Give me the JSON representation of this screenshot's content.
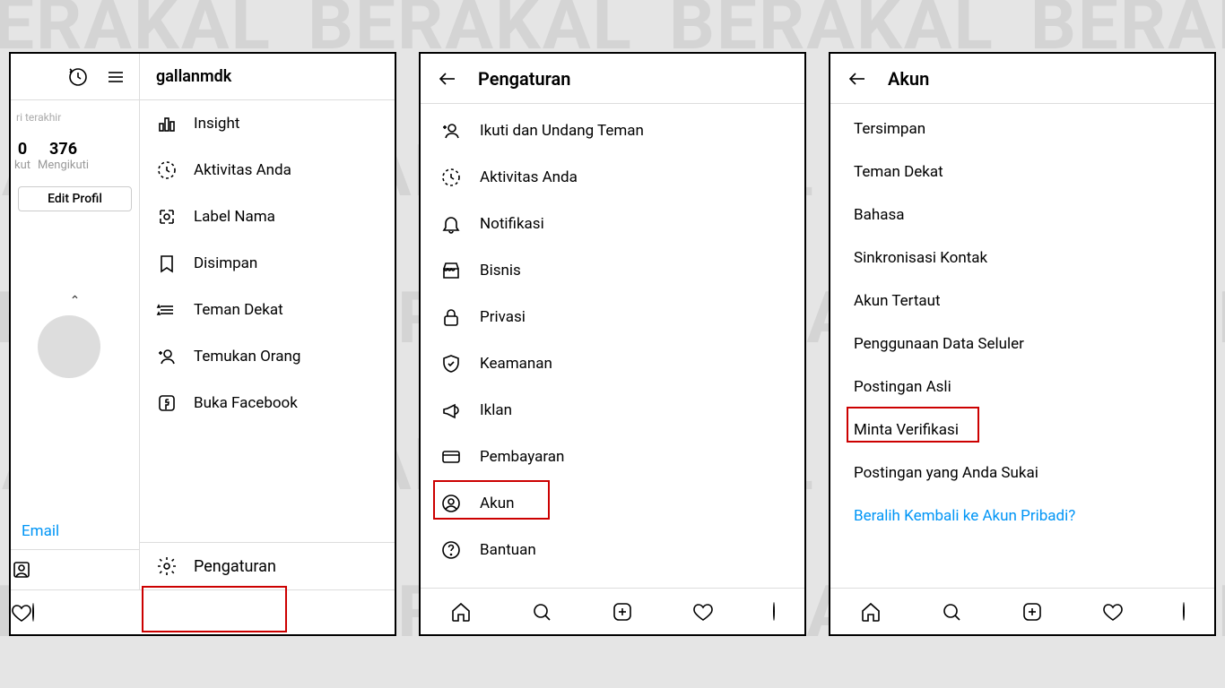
{
  "phone1": {
    "username": "gallanmdk",
    "tiny": "ri terakhir",
    "stat1_num": "0",
    "stat1_lbl": "kut",
    "stat2_num": "376",
    "stat2_lbl": "Mengikuti",
    "edit": "Edit Profil",
    "email": "Email",
    "menu": {
      "insight": "Insight",
      "aktivitas": "Aktivitas Anda",
      "label": "Label Nama",
      "disimpan": "Disimpan",
      "teman": "Teman Dekat",
      "temukan": "Temukan Orang",
      "facebook": "Buka Facebook",
      "pengaturan": "Pengaturan"
    }
  },
  "phone2": {
    "title": "Pengaturan",
    "items": {
      "ikuti": "Ikuti dan Undang Teman",
      "aktivitas": "Aktivitas Anda",
      "notifikasi": "Notifikasi",
      "bisnis": "Bisnis",
      "privasi": "Privasi",
      "keamanan": "Keamanan",
      "iklan": "Iklan",
      "pembayaran": "Pembayaran",
      "akun": "Akun",
      "bantuan": "Bantuan"
    }
  },
  "phone3": {
    "title": "Akun",
    "items": {
      "tersimpan": "Tersimpan",
      "teman": "Teman Dekat",
      "bahasa": "Bahasa",
      "sinkron": "Sinkronisasi Kontak",
      "tertaut": "Akun Tertaut",
      "data": "Penggunaan Data Seluler",
      "asli": "Postingan Asli",
      "verif": "Minta Verifikasi",
      "sukai": "Postingan yang Anda Sukai",
      "beralih": "Beralih Kembali ke Akun Pribadi?"
    }
  }
}
